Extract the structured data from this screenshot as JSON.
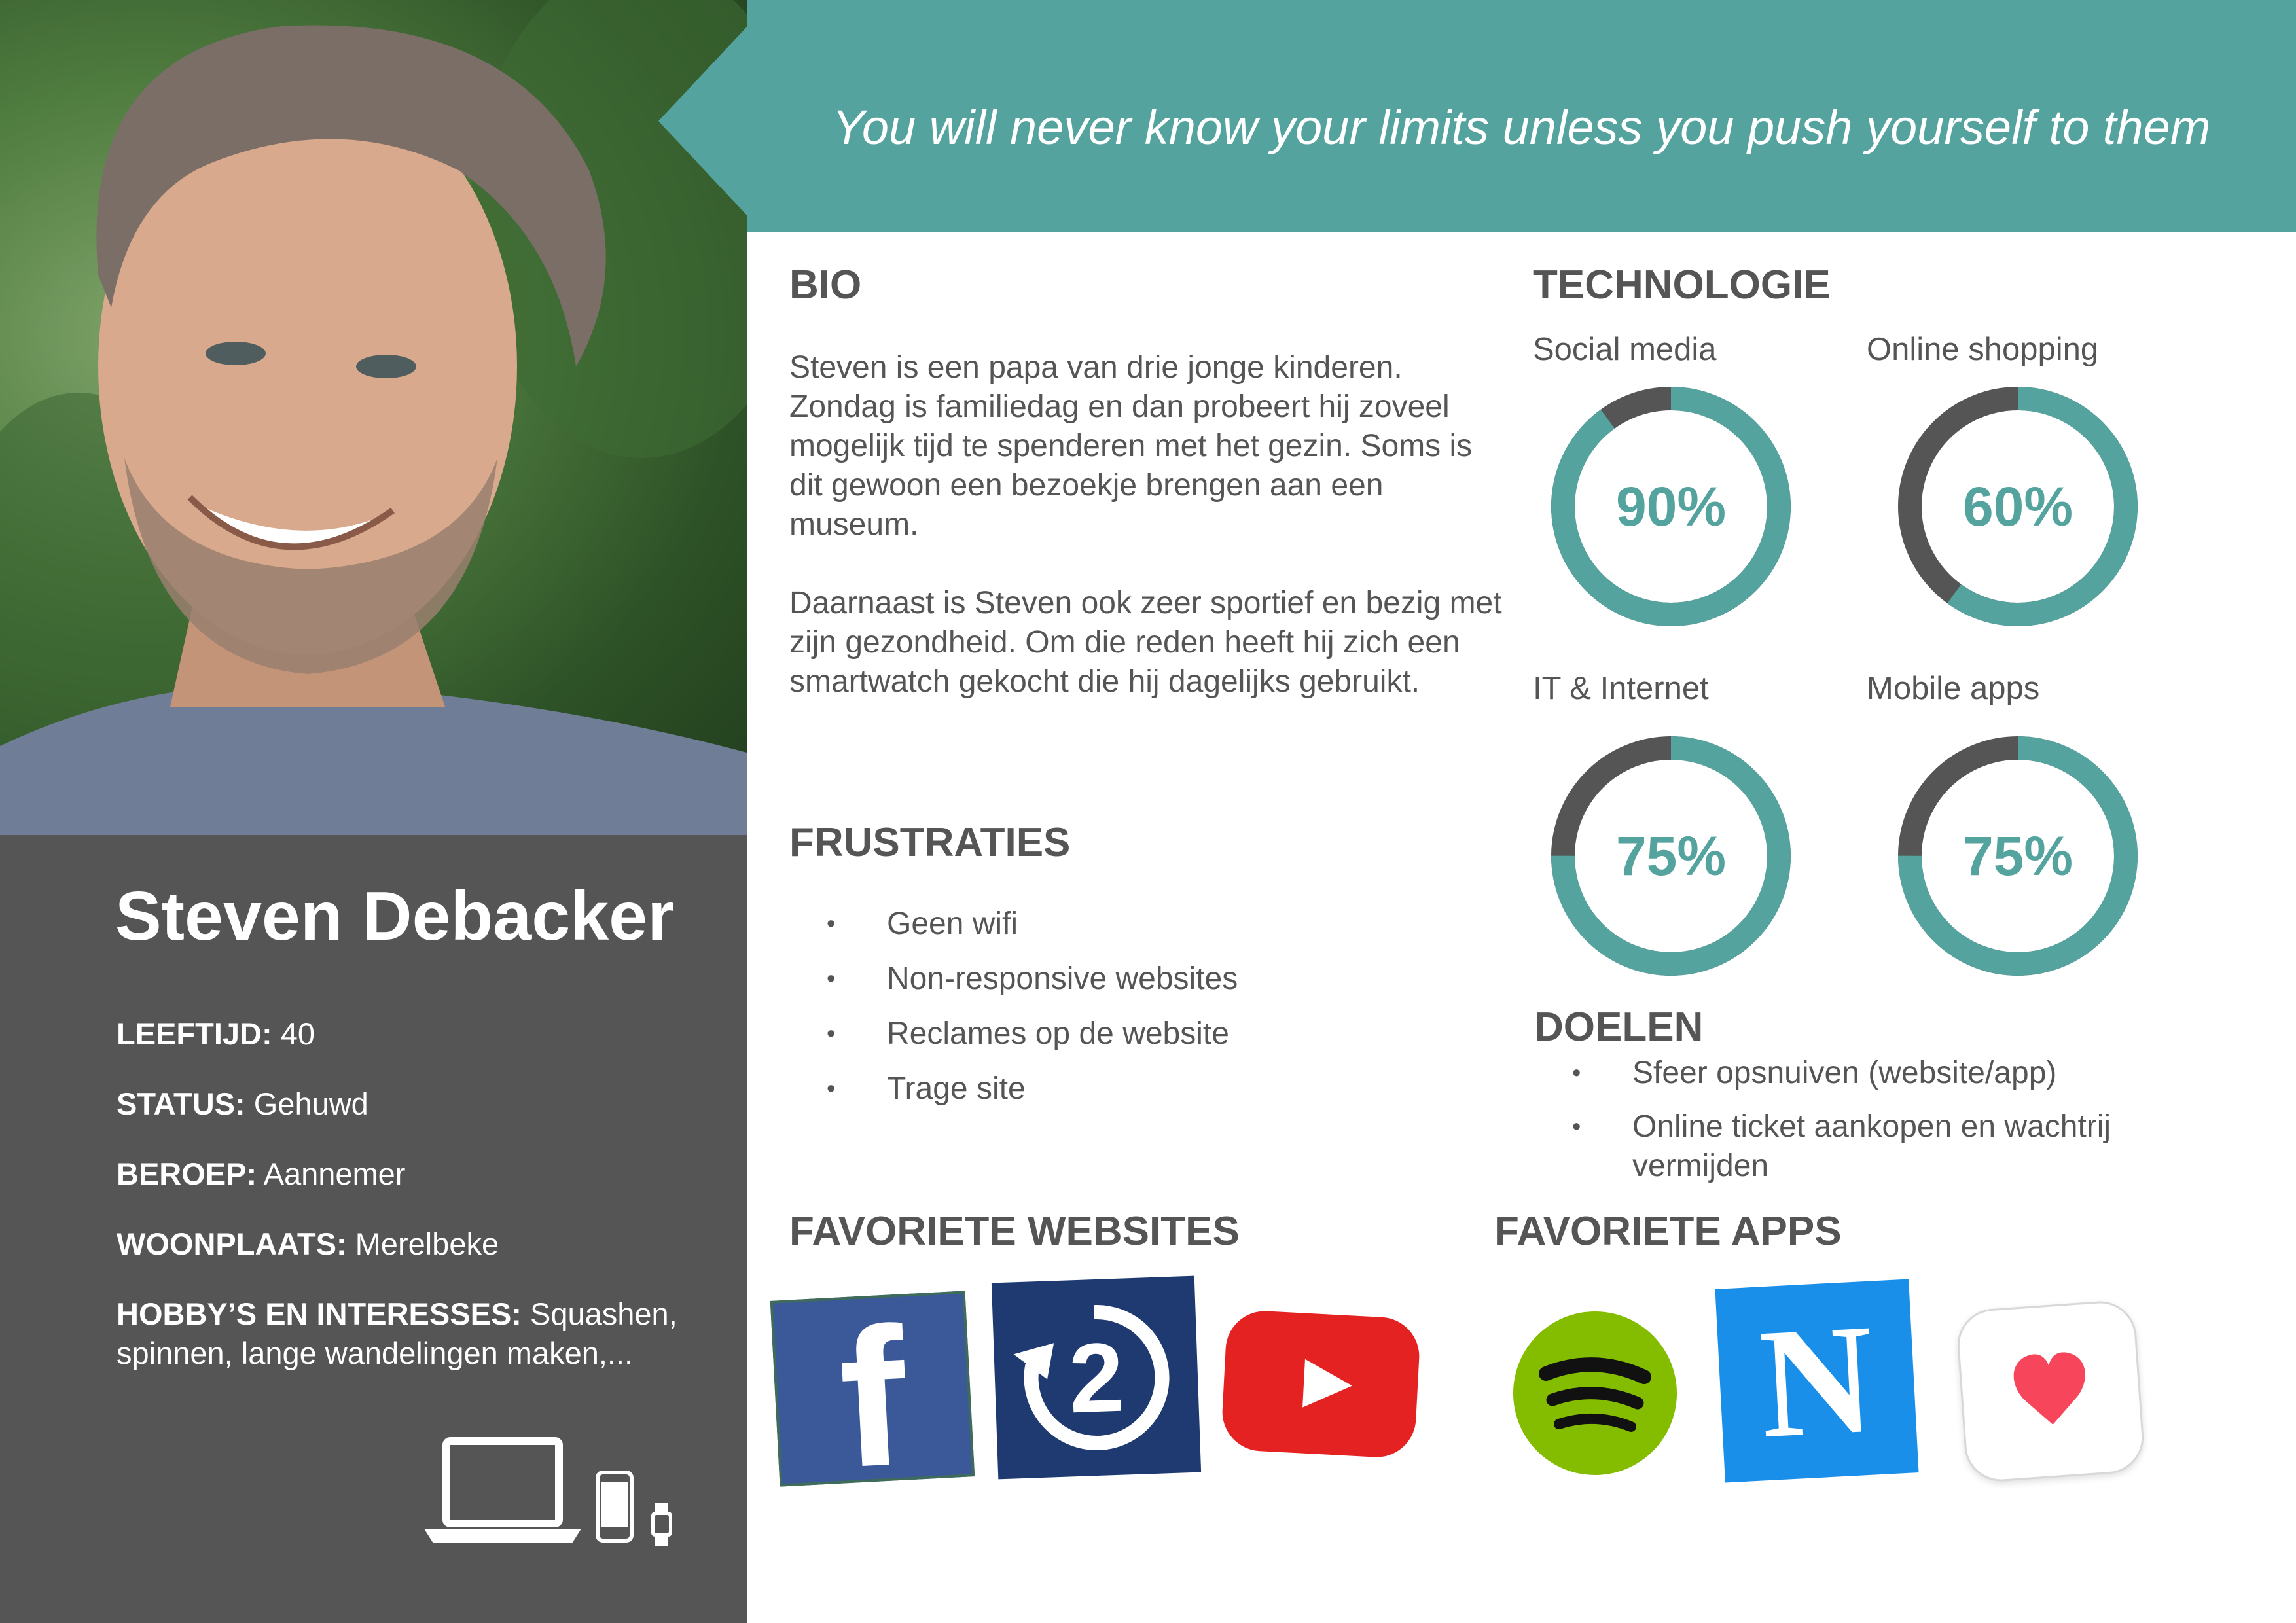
{
  "quote": "You will never know your limits unless you push yourself to them",
  "persona": {
    "name": "Steven Debacker",
    "facts": [
      {
        "label": "LEEFTIJD:",
        "value": "40"
      },
      {
        "label": "STATUS:",
        "value": "Gehuwd"
      },
      {
        "label": "BEROEP:",
        "value": "Aannemer"
      },
      {
        "label": "WOONPLAATS:",
        "value": "Merelbeke"
      },
      {
        "label": "HOBBY’S EN INTERESSES:",
        "value": "Squashen, spinnen, lange wandelingen maken,..."
      }
    ],
    "devices": [
      "laptop-icon",
      "smartphone-icon",
      "smartwatch-icon"
    ]
  },
  "bio": {
    "heading": "BIO",
    "paragraphs": [
      "Steven is een papa van drie jonge kinderen. Zondag is familiedag en dan probeert hij zoveel mogelijk tijd te spenderen met het gezin. Soms is dit gewoon een bezoekje brengen aan een museum.",
      "Daarnaast is Steven ook zeer sportief en bezig met zijn gezondheid. Om die reden heeft hij zich een smartwatch gekocht die hij dagelijks gebruikt."
    ]
  },
  "frustraties": {
    "heading": "FRUSTRATIES",
    "items": [
      "Geen wifi",
      "Non-responsive websites",
      "Reclames op de website",
      "Trage site"
    ]
  },
  "technologie": {
    "heading": "TECHNOLOGIE",
    "items": [
      {
        "label": "Social media",
        "value": 90,
        "display": "90%"
      },
      {
        "label": "Online shopping",
        "value": 60,
        "display": "60%"
      },
      {
        "label": "IT & Internet",
        "value": 75,
        "display": "75%"
      },
      {
        "label": "Mobile apps",
        "value": 75,
        "display": "75%"
      }
    ]
  },
  "doelen": {
    "heading": "DOELEN",
    "items": [
      "Sfeer opsnuiven (website/app)",
      "Online ticket aankopen en wachtrij vermijden"
    ]
  },
  "favoriete_websites": {
    "heading": "FAVORIETE WEBSITES",
    "items": [
      {
        "icon": "facebook-icon",
        "glyph": "f"
      },
      {
        "icon": "2dehands-icon",
        "glyph": "2"
      },
      {
        "icon": "youtube-icon"
      }
    ]
  },
  "favoriete_apps": {
    "heading": "FAVORIETE APPS",
    "items": [
      {
        "icon": "spotify-icon"
      },
      {
        "icon": "nieuwsblad-icon",
        "glyph": "N"
      },
      {
        "icon": "health-heart-icon"
      }
    ]
  },
  "colors": {
    "accent": "#54a39e",
    "panel": "#555555",
    "gauge_remainder": "#555555",
    "text": "#555555"
  },
  "bullet_glyph": "•"
}
